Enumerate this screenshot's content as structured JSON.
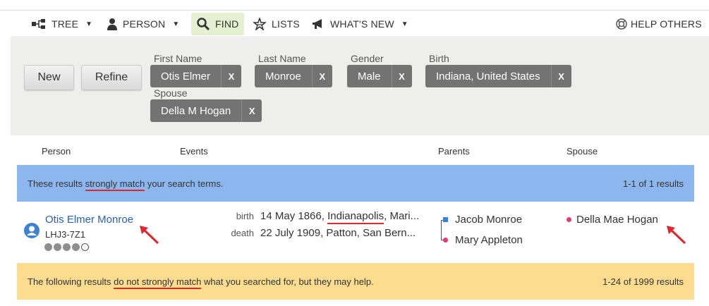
{
  "nav": {
    "tree": "TREE",
    "person": "PERSON",
    "find": "FIND",
    "lists": "LISTS",
    "whats_new": "WHAT'S NEW",
    "help": "HELP OTHERS"
  },
  "search": {
    "new_label": "New",
    "refine_label": "Refine",
    "fields": {
      "first_name": {
        "label": "First Name",
        "value": "Otis Elmer",
        "remove": "X"
      },
      "last_name": {
        "label": "Last Name",
        "value": "Monroe",
        "remove": "X"
      },
      "gender": {
        "label": "Gender",
        "value": "Male",
        "remove": "X"
      },
      "birth": {
        "label": "Birth",
        "value": "Indiana, United States",
        "remove": "X"
      },
      "spouse": {
        "label": "Spouse",
        "value": "Della M Hogan",
        "remove": "X"
      }
    }
  },
  "columns": {
    "person": "Person",
    "events": "Events",
    "parents": "Parents",
    "spouse": "Spouse"
  },
  "strong_band": {
    "text_before": "These results ",
    "text_highlight": "strongly match",
    "text_after": " your search terms.",
    "count": "1-1 of 1 results"
  },
  "result": {
    "name": "Otis Elmer Monroe",
    "id": "LHJ3-7Z1",
    "quality_filled": 4,
    "quality_total": 5,
    "birth_label": "birth",
    "birth_date": "14 May 1866, ",
    "birth_place_highlight": "Indianapolis",
    "birth_place_rest": ", Mari...",
    "death_label": "death",
    "death_value": "22 July 1909, Patton, San Bern...",
    "father": "Jacob Monroe",
    "mother": "Mary Appleton",
    "spouse": "Della Mae Hogan"
  },
  "weak_band": {
    "text_before": "The following results ",
    "text_highlight": "do not strongly match",
    "text_after": " what you searched for, but they may help.",
    "count": "1-24 of 1999 results"
  },
  "colors": {
    "strong_band": "#8bb7ee",
    "weak_band": "#fcdc8e",
    "chip": "#737373",
    "find_tab": "#e4f0cf",
    "annotation": "#e0262b",
    "link": "#2b5fb0"
  }
}
